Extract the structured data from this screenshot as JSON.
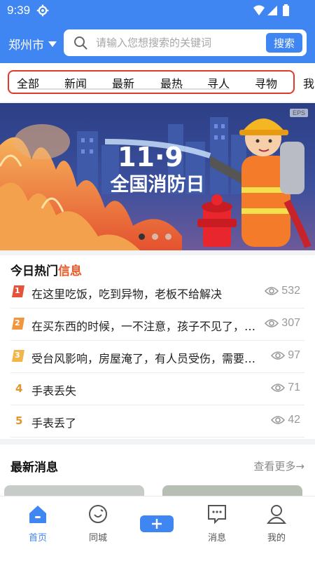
{
  "status": {
    "time": "9:39"
  },
  "header": {
    "city": "郑州市",
    "search_placeholder": "请输入您想搜索的关键词",
    "search_button": "搜索"
  },
  "tabs": [
    "全部",
    "新闻",
    "最新",
    "最热",
    "寻人",
    "寻物",
    "我"
  ],
  "banner": {
    "title_line1": "11·9",
    "title_line2": "全国消防日",
    "eps_tag": "EPS",
    "slide_count": 3,
    "active_slide": 1
  },
  "hot": {
    "title_prefix": "今日热门",
    "title_highlight": "信息",
    "items": [
      {
        "rank": "1",
        "text": "在这里吃饭，吃到异物，老板不给解决",
        "views": "532"
      },
      {
        "rank": "2",
        "text": "在买东西的时候，一不注意，孩子不见了，就…",
        "views": "307"
      },
      {
        "rank": "3",
        "text": "受台风影响，房屋淹了，有人员受伤，需要紧…",
        "views": "97"
      },
      {
        "rank": "4",
        "text": "手表丢失",
        "views": "71"
      },
      {
        "rank": "5",
        "text": "手表丢了",
        "views": "42"
      }
    ]
  },
  "latest": {
    "title": "最新消息",
    "more": "查看更多→"
  },
  "nav": {
    "home": "首页",
    "city": "同城",
    "messages": "消息",
    "mine": "我的"
  },
  "colors": {
    "primary": "#3f86f2",
    "highlight": "#ea5a2a",
    "tab_outline": "#e23a2a"
  }
}
